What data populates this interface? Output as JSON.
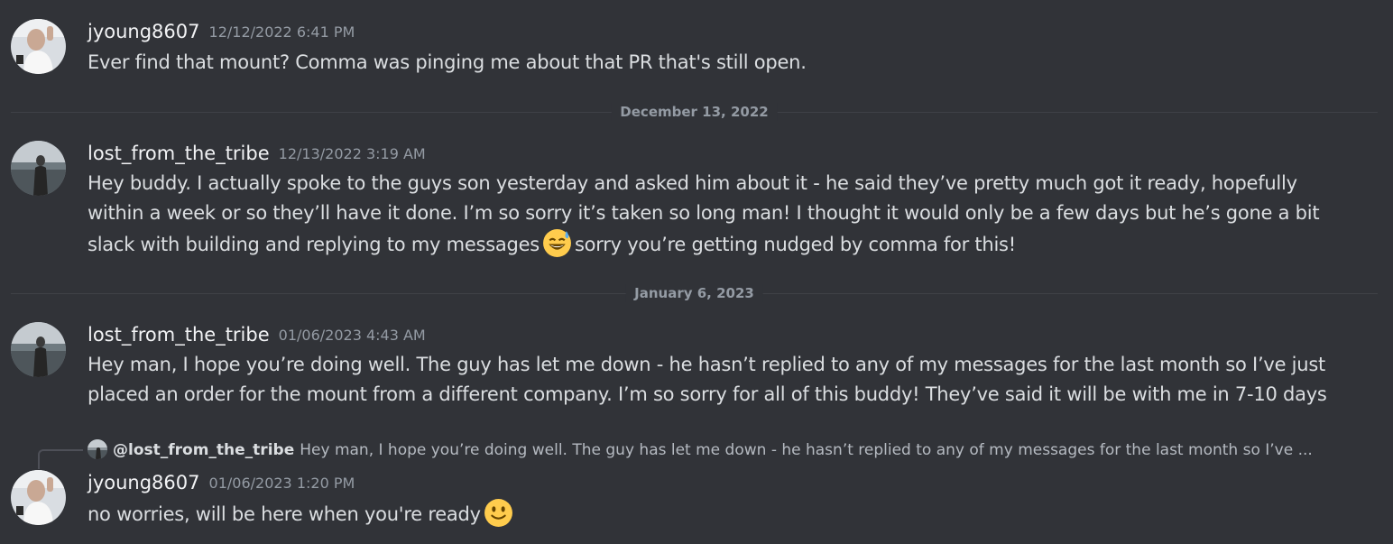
{
  "messages": [
    {
      "username": "jyoung8607",
      "timestamp": "12/12/2022 6:41 PM",
      "content": "Ever find that mount? Comma was pinging me about that PR that's still open."
    },
    {
      "username": "lost_from_the_tribe",
      "timestamp": "12/13/2022 3:19 AM",
      "content_part1": "Hey buddy. I actually spoke to the guys son yesterday and asked him about it - he said they’ve pretty much got it ready, hopefully within a week or so they’ll have it done. I’m so sorry it’s taken so long man! I thought it would only be a few days but he’s gone a bit slack with building and replying to my messages",
      "emoji": "sweat-smile-emoji",
      "content_part2": "sorry you’re getting nudged by comma for this!"
    },
    {
      "username": "lost_from_the_tribe",
      "timestamp": "01/06/2023 4:43 AM",
      "content": "Hey man, I hope you’re doing well. The guy has let me down - he hasn’t replied to any of my messages for the last month so I’ve just placed an order for the mount from a different company. I’m so sorry for all of this buddy! They’ve said it will be with me in 7-10 days"
    },
    {
      "reply_to": {
        "name": "@lost_from_the_tribe",
        "preview": "Hey man, I hope you’re doing well. The guy has let me down - he hasn’t replied to any of my messages for the last month so I’ve ..."
      },
      "username": "jyoung8607",
      "timestamp": "01/06/2023 1:20 PM",
      "content": "no worries, will be here when you're ready",
      "emoji": "slight-smile-emoji"
    }
  ],
  "dividers": [
    "December 13, 2022",
    "January 6, 2023"
  ],
  "colors": {
    "background": "#313338",
    "username": "#f2f3f5",
    "text": "#dbdee1",
    "muted": "#949ba4",
    "divider": "#3f4147"
  }
}
